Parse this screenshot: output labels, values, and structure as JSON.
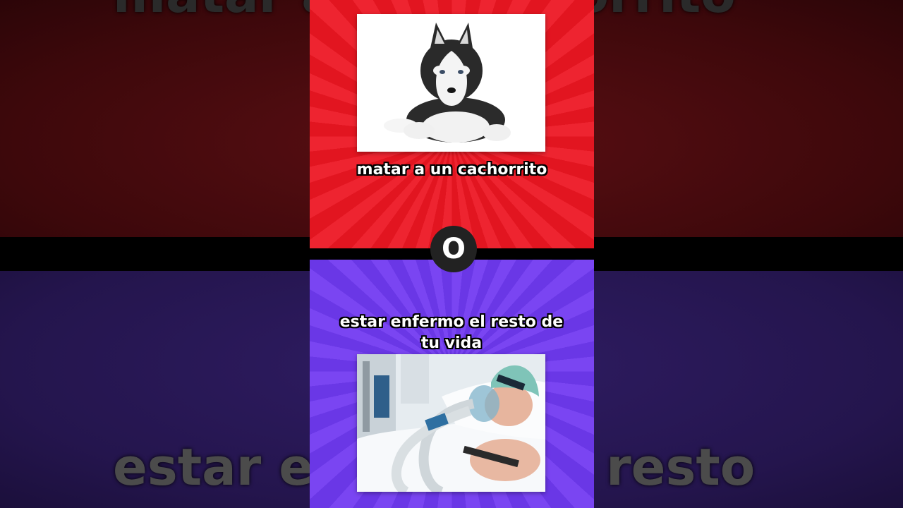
{
  "background": {
    "top_text": "matar a un cachorrito",
    "bottom_text": "estar enfermo el resto"
  },
  "option_a": {
    "caption": "matar a un cachorrito",
    "color": "#e8202b",
    "image": "husky-puppy"
  },
  "separator": {
    "label": "O"
  },
  "option_b": {
    "caption": "estar enfermo el resto de tu vida",
    "color": "#7341ee",
    "image": "hospital-patient-ventilator"
  }
}
